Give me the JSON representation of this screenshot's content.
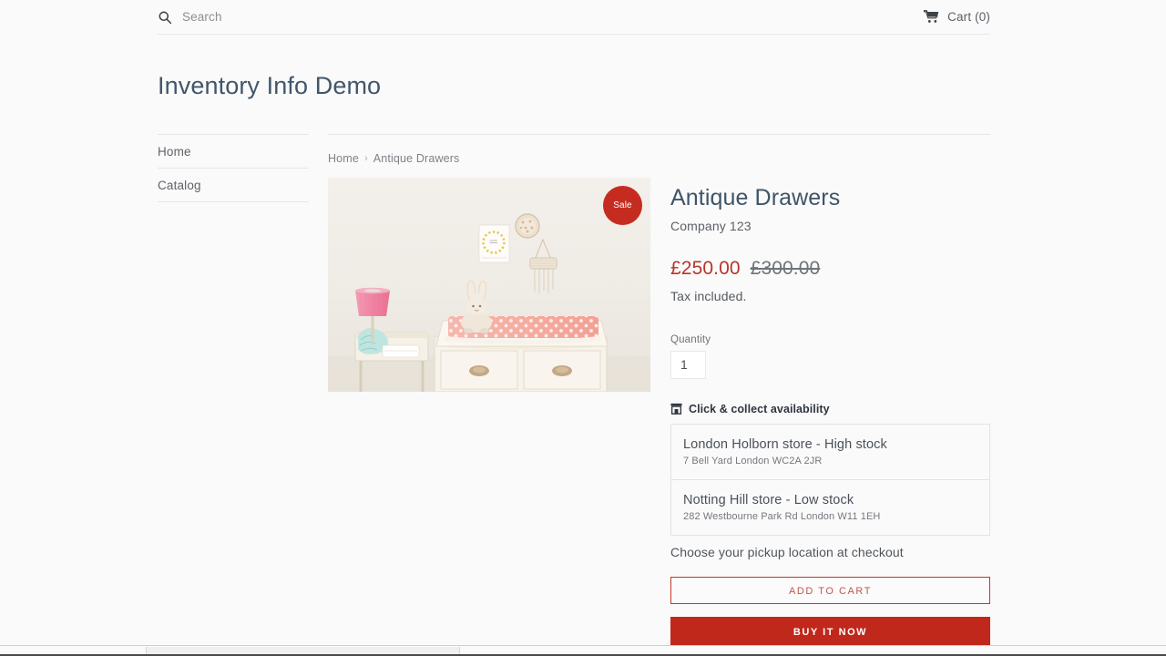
{
  "header": {
    "search_placeholder": "Search",
    "search_icon": "search-icon",
    "cart_icon": "cart-icon",
    "cart_label": "Cart (0)"
  },
  "shop": {
    "title": "Inventory Info Demo"
  },
  "sidebar": {
    "items": [
      {
        "label": "Home"
      },
      {
        "label": "Catalog"
      }
    ]
  },
  "breadcrumb": {
    "home": "Home",
    "separator": "›",
    "current": "Antique Drawers"
  },
  "product": {
    "title": "Antique Drawers",
    "vendor": "Company 123",
    "sale_badge": "Sale",
    "price_sale": "£250.00",
    "price_compare": "£300.00",
    "tax_note": "Tax included.",
    "quantity_label": "Quantity",
    "quantity_value": "1",
    "image_alt": "Nursery with antique white changing table, pink lamp and bunny toy"
  },
  "click_collect": {
    "icon": "store-icon",
    "heading": "Click & collect availability",
    "stores": [
      {
        "name": "London Holborn store - High stock",
        "address": "7 Bell Yard London WC2A 2JR"
      },
      {
        "name": "Notting Hill store - Low stock",
        "address": "282 Westbourne Park Rd London W11 1EH"
      }
    ],
    "pickup_note": "Choose your pickup location at checkout"
  },
  "actions": {
    "add_to_cart": "ADD TO CART",
    "buy_it_now": "BUY IT NOW"
  },
  "colors": {
    "page_background": "#fafafa",
    "brand_red": "#c0281c",
    "sale_price": "#b7352a",
    "title_slate": "#42566b",
    "border": "#e6e6e6"
  }
}
